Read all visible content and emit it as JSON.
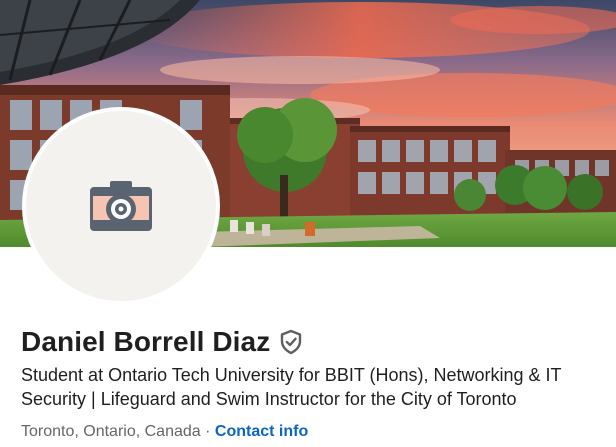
{
  "profile": {
    "name": "Daniel Borrell Diaz",
    "headline_line1": "Student at Ontario Tech University for BBIT (Hons), Networking & IT",
    "headline_line2": "Security | Lifeguard and Swim Instructor for the City of Toronto",
    "location": "Toronto, Ontario, Canada",
    "separator": " · ",
    "contact_label": "Contact info"
  },
  "icons": {
    "avatar": "camera-icon",
    "badge": "verified-shield-icon"
  },
  "colors": {
    "link": "#0a66c2",
    "name_text": "#1f1f1f",
    "meta_text": "#666666",
    "avatar_bg": "#f4f2ee",
    "camera_body": "#f6c4b3",
    "camera_dark": "#5a6470"
  }
}
